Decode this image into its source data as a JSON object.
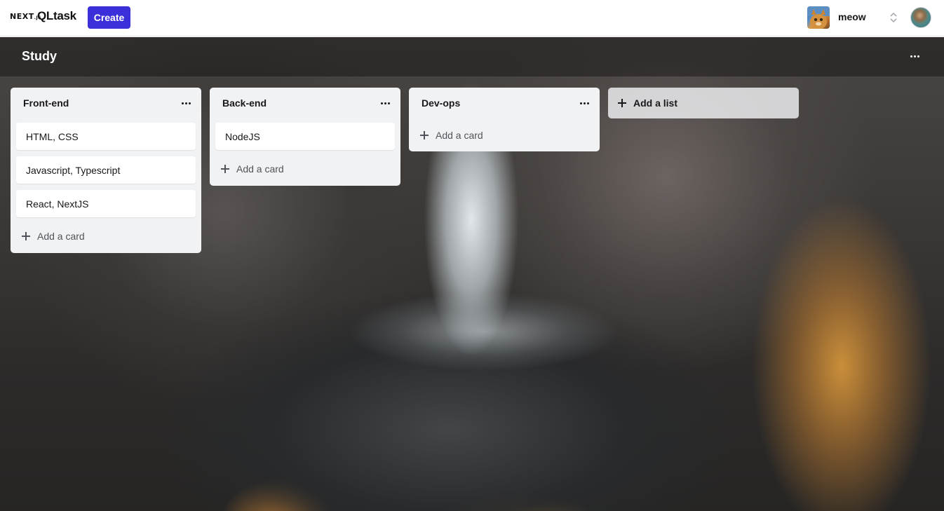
{
  "nav": {
    "logo_next": "NEXT",
    "logo_next_suffix": ".JS",
    "brand": "QLtask",
    "create_label": "Create",
    "workspace_name": "meow",
    "icons": [
      "workspace-avatar",
      "chevron-up-down-icon",
      "user-avatar"
    ]
  },
  "board": {
    "title": "Study",
    "menu_icon": "more-horizontal-icon"
  },
  "lists": [
    {
      "title": "Front-end",
      "cards": [
        "HTML, CSS",
        "Javascript, Typescript",
        "React, NextJS"
      ],
      "add_card_label": "Add a card"
    },
    {
      "title": "Back-end",
      "cards": [
        "NodeJS"
      ],
      "add_card_label": "Add a card"
    },
    {
      "title": "Dev-ops",
      "cards": [],
      "add_card_label": "Add a card"
    }
  ],
  "add_list_label": "Add a list",
  "colors": {
    "accent": "#3b2fd9",
    "list_bg": "#f1f2f4",
    "card_bg": "#ffffff"
  }
}
